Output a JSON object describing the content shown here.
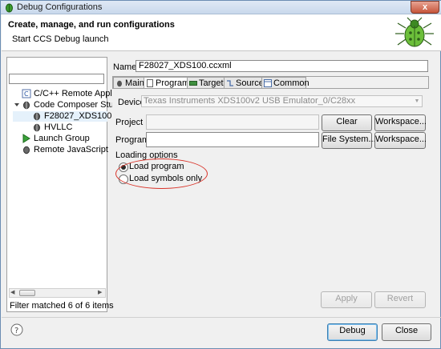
{
  "window": {
    "title": "Debug Configurations",
    "close_label": "x"
  },
  "header": {
    "title": "Create, manage, and run configurations",
    "subtitle": "Start CCS Debug launch"
  },
  "left": {
    "tree": [
      {
        "label": "C/C++ Remote Applic",
        "icon": "c-app-icon",
        "indent": 1
      },
      {
        "label": "Code Composer Stud",
        "icon": "ccs-bug-icon",
        "indent": 1
      },
      {
        "label": "F28027_XDS100.cc",
        "icon": "ccs-bug-icon",
        "indent": 2
      },
      {
        "label": "HVLLC",
        "icon": "ccs-bug-icon",
        "indent": 2
      },
      {
        "label": "Launch Group",
        "icon": "launch-group-icon",
        "indent": 1
      },
      {
        "label": "Remote JavaScript",
        "icon": "remote-js-icon",
        "indent": 1
      }
    ],
    "filter_status": "Filter matched 6 of 6 items"
  },
  "config": {
    "name_label": "Name:",
    "name_value": "F28027_XDS100.ccxml",
    "tabs": [
      {
        "label": "Main",
        "icon": "main-tab-icon"
      },
      {
        "label": "Program",
        "icon": "program-tab-icon",
        "active": true
      },
      {
        "label": "Target",
        "icon": "target-tab-icon"
      },
      {
        "label": "Source",
        "icon": "source-tab-icon"
      },
      {
        "label": "Common",
        "icon": "common-tab-icon"
      }
    ],
    "device_label": "Device",
    "device_value": "Texas Instruments XDS100v2 USB Emulator_0/C28xx",
    "project_label": "Project",
    "program_label": "Program",
    "clear_label": "Clear",
    "workspace_label_1": "Workspace...",
    "filesystem_label": "File System...",
    "workspace_label_2": "Workspace...",
    "loading_options_label": "Loading options",
    "load_program_label": "Load program",
    "load_symbols_label": "Load symbols only",
    "selected_option": "Load program"
  },
  "footer": {
    "apply_label": "Apply",
    "revert_label": "Revert",
    "debug_label": "Debug",
    "close_label": "Close"
  },
  "colors": {
    "annotation": "#d9342a",
    "accent": "#3c7fb1"
  }
}
